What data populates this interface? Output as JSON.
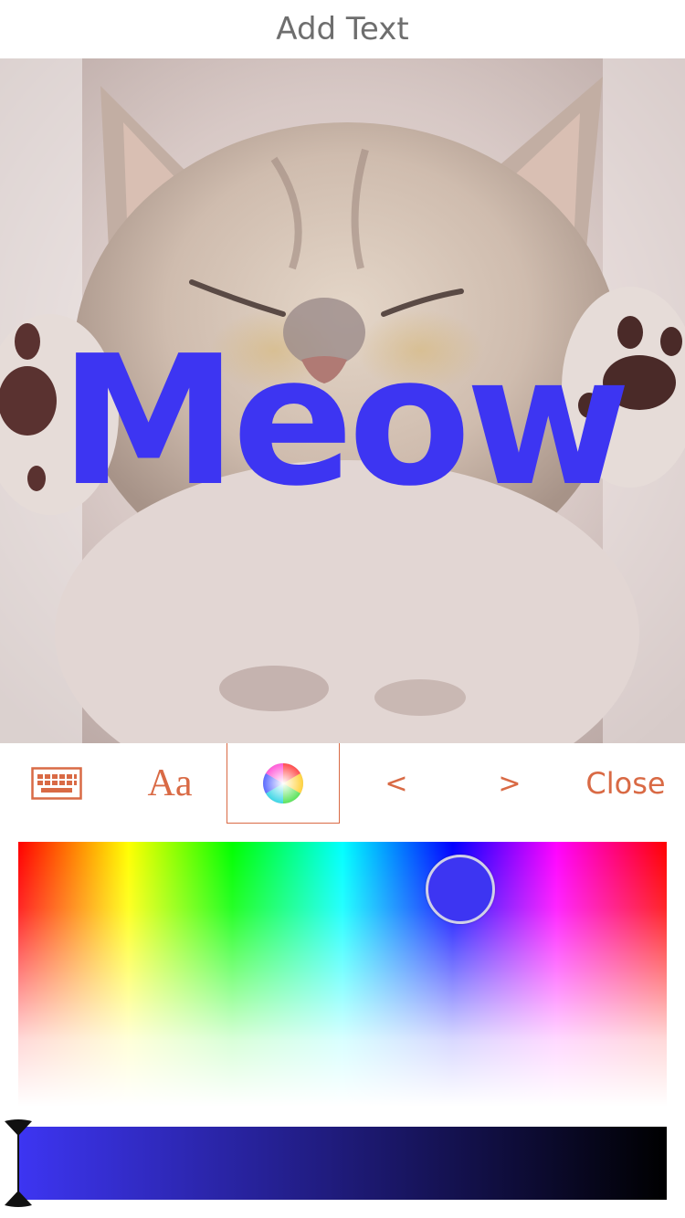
{
  "header": {
    "title": "Add Text"
  },
  "canvas": {
    "overlay_text": "Meow",
    "text_color": "#3d35f2"
  },
  "toolbar": {
    "keyboard_icon": "keyboard-icon",
    "font_label": "Aa",
    "color_icon": "color-wheel-icon",
    "prev_label": "<",
    "next_label": ">",
    "close_label": "Close",
    "accent_color": "#d96a45"
  },
  "color_picker": {
    "selected_color": "#3d35f2",
    "brightness": 1.0
  }
}
